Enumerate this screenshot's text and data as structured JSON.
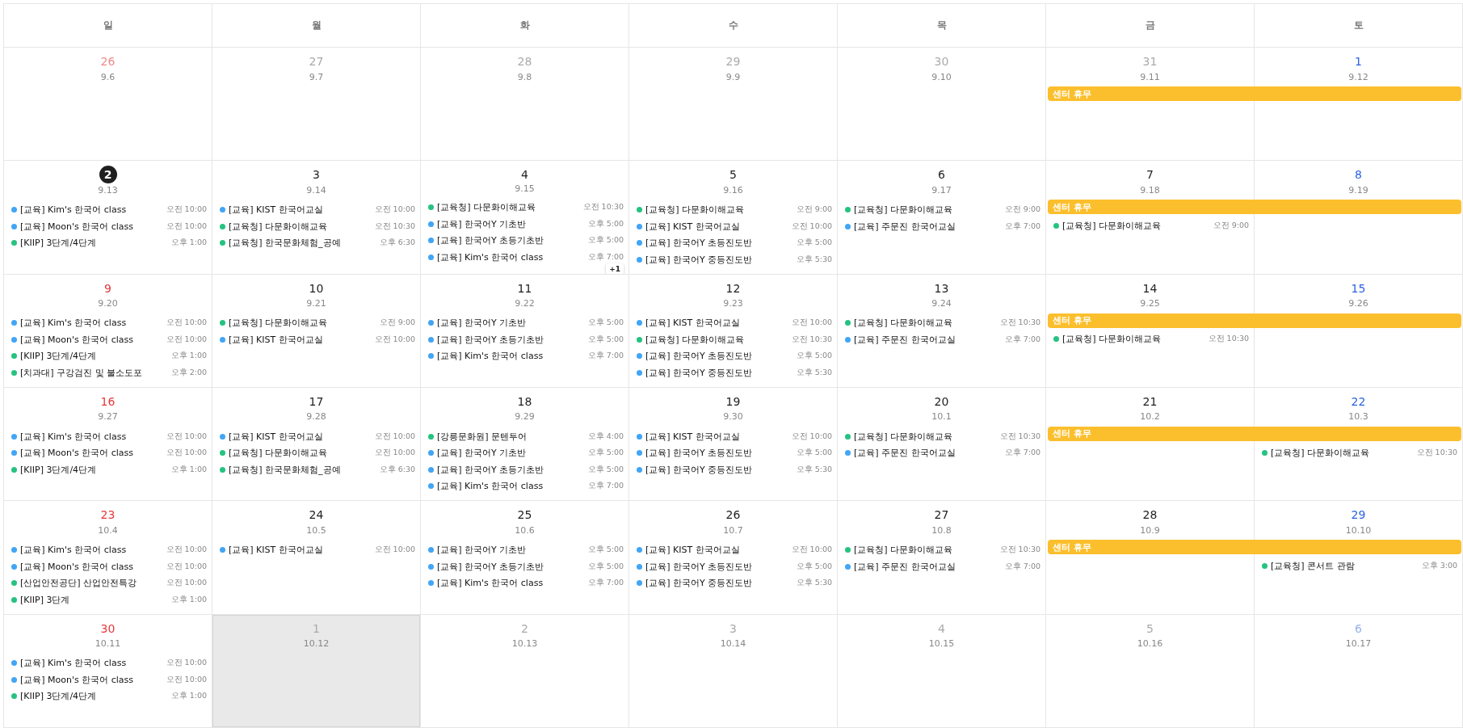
{
  "weekdays": [
    "일",
    "월",
    "화",
    "수",
    "목",
    "금",
    "토"
  ],
  "weeks": [
    {
      "days": [
        {
          "number": "26",
          "lunar": "9.6",
          "other_month": true,
          "today": false,
          "selected": false
        },
        {
          "number": "27",
          "lunar": "9.7",
          "other_month": true,
          "today": false,
          "selected": false
        },
        {
          "number": "28",
          "lunar": "9.8",
          "other_month": true,
          "today": false,
          "selected": false
        },
        {
          "number": "29",
          "lunar": "9.9",
          "other_month": true,
          "today": false,
          "selected": false
        },
        {
          "number": "30",
          "lunar": "9.10",
          "other_month": true,
          "today": false,
          "selected": false
        },
        {
          "number": "31",
          "lunar": "9.11",
          "other_month": true,
          "today": false,
          "selected": false,
          "all_day": {
            "title": "센터 휴무",
            "color": "#fbbf2d"
          }
        },
        {
          "number": "1",
          "lunar": "9.12",
          "other_month": false,
          "today": false,
          "selected": false,
          "all_day_continues": true
        }
      ]
    },
    {
      "days": [
        {
          "number": "2",
          "lunar": "9.13",
          "other_month": false,
          "today": true,
          "selected": false,
          "events": [
            {
              "title": "[교육] Kim's 한국어 class",
              "time": "오전 10:00",
              "color": "#42a5f5"
            },
            {
              "title": "[교육] Moon's 한국어 class",
              "time": "오전 10:00",
              "color": "#42a5f5"
            },
            {
              "title": "[KIIP] 3단계/4단계",
              "time": "오후 1:00",
              "color": "#26c281"
            }
          ]
        },
        {
          "number": "3",
          "lunar": "9.14",
          "other_month": false,
          "today": false,
          "selected": false,
          "events": [
            {
              "title": "[교육] KIST 한국어교실",
              "time": "오전 10:00",
              "color": "#42a5f5"
            },
            {
              "title": "[교육청] 다문화이해교육",
              "time": "오전 10:30",
              "color": "#26c281"
            },
            {
              "title": "[교육청] 한국문화체험_공예",
              "time": "오후 6:30",
              "color": "#26c281"
            }
          ]
        },
        {
          "number": "4",
          "lunar": "9.15",
          "other_month": false,
          "today": false,
          "selected": false,
          "more": "+1",
          "events": [
            {
              "title": "[교육청] 다문화이해교육",
              "time": "오전 10:30",
              "color": "#26c281"
            },
            {
              "title": "[교육] 한국어Y 기초반",
              "time": "오후 5:00",
              "color": "#42a5f5"
            },
            {
              "title": "[교육] 한국어Y 초등기초반",
              "time": "오후 5:00",
              "color": "#42a5f5"
            },
            {
              "title": "[교육] Kim's 한국어 class",
              "time": "오후 7:00",
              "color": "#42a5f5"
            }
          ]
        },
        {
          "number": "5",
          "lunar": "9.16",
          "other_month": false,
          "today": false,
          "selected": false,
          "events": [
            {
              "title": "[교육청] 다문화이해교육",
              "time": "오전 9:00",
              "color": "#26c281"
            },
            {
              "title": "[교육] KIST 한국어교실",
              "time": "오전 10:00",
              "color": "#42a5f5"
            },
            {
              "title": "[교육] 한국어Y 초등진도반",
              "time": "오후 5:00",
              "color": "#42a5f5"
            },
            {
              "title": "[교육] 한국어Y 중등진도반",
              "time": "오후 5:30",
              "color": "#42a5f5"
            }
          ]
        },
        {
          "number": "6",
          "lunar": "9.17",
          "other_month": false,
          "today": false,
          "selected": false,
          "events": [
            {
              "title": "[교육청] 다문화이해교육",
              "time": "오전 9:00",
              "color": "#26c281"
            },
            {
              "title": "[교육] 주문진 한국어교실",
              "time": "오후 7:00",
              "color": "#42a5f5"
            }
          ]
        },
        {
          "number": "7",
          "lunar": "9.18",
          "other_month": false,
          "today": false,
          "selected": false,
          "all_day": {
            "title": "센터 휴무",
            "color": "#fbbf2d"
          },
          "events": [
            {
              "title": "[교육청] 다문화이해교육",
              "time": "오전 9:00",
              "color": "#26c281"
            }
          ]
        },
        {
          "number": "8",
          "lunar": "9.19",
          "other_month": false,
          "today": false,
          "selected": false,
          "all_day_continues": true
        }
      ]
    },
    {
      "days": [
        {
          "number": "9",
          "lunar": "9.20",
          "other_month": false,
          "today": false,
          "selected": false,
          "events": [
            {
              "title": "[교육] Kim's 한국어 class",
              "time": "오전 10:00",
              "color": "#42a5f5"
            },
            {
              "title": "[교육] Moon's 한국어 class",
              "time": "오전 10:00",
              "color": "#42a5f5"
            },
            {
              "title": "[KIIP] 3단계/4단계",
              "time": "오후 1:00",
              "color": "#26c281"
            },
            {
              "title": "[치과대] 구강검진 및 불소도포",
              "time": "오후 2:00",
              "color": "#26c281"
            }
          ]
        },
        {
          "number": "10",
          "lunar": "9.21",
          "other_month": false,
          "today": false,
          "selected": false,
          "events": [
            {
              "title": "[교육청] 다문화이해교육",
              "time": "오전 9:00",
              "color": "#26c281"
            },
            {
              "title": "[교육] KIST 한국어교실",
              "time": "오전 10:00",
              "color": "#42a5f5"
            }
          ]
        },
        {
          "number": "11",
          "lunar": "9.22",
          "other_month": false,
          "today": false,
          "selected": false,
          "events": [
            {
              "title": "[교육] 한국어Y 기초반",
              "time": "오후 5:00",
              "color": "#42a5f5"
            },
            {
              "title": "[교육] 한국어Y 초등기초반",
              "time": "오후 5:00",
              "color": "#42a5f5"
            },
            {
              "title": "[교육] Kim's 한국어 class",
              "time": "오후 7:00",
              "color": "#42a5f5"
            }
          ]
        },
        {
          "number": "12",
          "lunar": "9.23",
          "other_month": false,
          "today": false,
          "selected": false,
          "events": [
            {
              "title": "[교육] KIST 한국어교실",
              "time": "오전 10:00",
              "color": "#42a5f5"
            },
            {
              "title": "[교육청] 다문화이해교육",
              "time": "오전 10:30",
              "color": "#26c281"
            },
            {
              "title": "[교육] 한국어Y 초등진도반",
              "time": "오후 5:00",
              "color": "#42a5f5"
            },
            {
              "title": "[교육] 한국어Y 중등진도반",
              "time": "오후 5:30",
              "color": "#42a5f5"
            }
          ]
        },
        {
          "number": "13",
          "lunar": "9.24",
          "other_month": false,
          "today": false,
          "selected": false,
          "events": [
            {
              "title": "[교육청] 다문화이해교육",
              "time": "오전 10:30",
              "color": "#26c281"
            },
            {
              "title": "[교육] 주문진 한국어교실",
              "time": "오후 7:00",
              "color": "#42a5f5"
            }
          ]
        },
        {
          "number": "14",
          "lunar": "9.25",
          "other_month": false,
          "today": false,
          "selected": false,
          "all_day": {
            "title": "센터 휴무",
            "color": "#fbbf2d"
          },
          "events": [
            {
              "title": "[교육청] 다문화이해교육",
              "time": "오전 10:30",
              "color": "#26c281"
            }
          ]
        },
        {
          "number": "15",
          "lunar": "9.26",
          "other_month": false,
          "today": false,
          "selected": false,
          "all_day_continues": true
        }
      ]
    },
    {
      "days": [
        {
          "number": "16",
          "lunar": "9.27",
          "other_month": false,
          "today": false,
          "selected": false,
          "events": [
            {
              "title": "[교육] Kim's 한국어 class",
              "time": "오전 10:00",
              "color": "#42a5f5"
            },
            {
              "title": "[교육] Moon's 한국어 class",
              "time": "오전 10:00",
              "color": "#42a5f5"
            },
            {
              "title": "[KIIP] 3단계/4단계",
              "time": "오후 1:00",
              "color": "#26c281"
            }
          ]
        },
        {
          "number": "17",
          "lunar": "9.28",
          "other_month": false,
          "today": false,
          "selected": false,
          "events": [
            {
              "title": "[교육] KIST 한국어교실",
              "time": "오전 10:00",
              "color": "#42a5f5"
            },
            {
              "title": "[교육청] 다문화이해교육",
              "time": "오전 10:00",
              "color": "#26c281"
            },
            {
              "title": "[교육청] 한국문화체험_공예",
              "time": "오후 6:30",
              "color": "#26c281"
            }
          ]
        },
        {
          "number": "18",
          "lunar": "9.29",
          "other_month": false,
          "today": false,
          "selected": false,
          "events": [
            {
              "title": "[강릉문화원] 문텐투어",
              "time": "오후 4:00",
              "color": "#26c281"
            },
            {
              "title": "[교육] 한국어Y 기초반",
              "time": "오후 5:00",
              "color": "#42a5f5"
            },
            {
              "title": "[교육] 한국어Y 초등기초반",
              "time": "오후 5:00",
              "color": "#42a5f5"
            },
            {
              "title": "[교육] Kim's 한국어 class",
              "time": "오후 7:00",
              "color": "#42a5f5"
            }
          ]
        },
        {
          "number": "19",
          "lunar": "9.30",
          "other_month": false,
          "today": false,
          "selected": false,
          "events": [
            {
              "title": "[교육] KIST 한국어교실",
              "time": "오전 10:00",
              "color": "#42a5f5"
            },
            {
              "title": "[교육] 한국어Y 초등진도반",
              "time": "오후 5:00",
              "color": "#42a5f5"
            },
            {
              "title": "[교육] 한국어Y 중등진도반",
              "time": "오후 5:30",
              "color": "#42a5f5"
            }
          ]
        },
        {
          "number": "20",
          "lunar": "10.1",
          "other_month": false,
          "today": false,
          "selected": false,
          "events": [
            {
              "title": "[교육청] 다문화이해교육",
              "time": "오전 10:30",
              "color": "#26c281"
            },
            {
              "title": "[교육] 주문진 한국어교실",
              "time": "오후 7:00",
              "color": "#42a5f5"
            }
          ]
        },
        {
          "number": "21",
          "lunar": "10.2",
          "other_month": false,
          "today": false,
          "selected": false,
          "all_day": {
            "title": "센터 휴무",
            "color": "#fbbf2d"
          }
        },
        {
          "number": "22",
          "lunar": "10.3",
          "other_month": false,
          "today": false,
          "selected": false,
          "all_day_continues": true,
          "events": [
            {
              "title": "[교육청] 다문화이해교육",
              "time": "오전 10:30",
              "color": "#26c281"
            }
          ]
        }
      ]
    },
    {
      "days": [
        {
          "number": "23",
          "lunar": "10.4",
          "other_month": false,
          "today": false,
          "selected": false,
          "events": [
            {
              "title": "[교육] Kim's 한국어 class",
              "time": "오전 10:00",
              "color": "#42a5f5"
            },
            {
              "title": "[교육] Moon's 한국어 class",
              "time": "오전 10:00",
              "color": "#42a5f5"
            },
            {
              "title": "[산업안전공단] 산업안전특강",
              "time": "오전 10:00",
              "color": "#26c281"
            },
            {
              "title": "[KIIP] 3단계",
              "time": "오후 1:00",
              "color": "#26c281"
            }
          ]
        },
        {
          "number": "24",
          "lunar": "10.5",
          "other_month": false,
          "today": false,
          "selected": false,
          "events": [
            {
              "title": "[교육] KIST 한국어교실",
              "time": "오전 10:00",
              "color": "#42a5f5"
            }
          ]
        },
        {
          "number": "25",
          "lunar": "10.6",
          "other_month": false,
          "today": false,
          "selected": false,
          "events": [
            {
              "title": "[교육] 한국어Y 기초반",
              "time": "오후 5:00",
              "color": "#42a5f5"
            },
            {
              "title": "[교육] 한국어Y 초등기초반",
              "time": "오후 5:00",
              "color": "#42a5f5"
            },
            {
              "title": "[교육] Kim's 한국어 class",
              "time": "오후 7:00",
              "color": "#42a5f5"
            }
          ]
        },
        {
          "number": "26",
          "lunar": "10.7",
          "other_month": false,
          "today": false,
          "selected": false,
          "events": [
            {
              "title": "[교육] KIST 한국어교실",
              "time": "오전 10:00",
              "color": "#42a5f5"
            },
            {
              "title": "[교육] 한국어Y 초등진도반",
              "time": "오후 5:00",
              "color": "#42a5f5"
            },
            {
              "title": "[교육] 한국어Y 중등진도반",
              "time": "오후 5:30",
              "color": "#42a5f5"
            }
          ]
        },
        {
          "number": "27",
          "lunar": "10.8",
          "other_month": false,
          "today": false,
          "selected": false,
          "events": [
            {
              "title": "[교육청] 다문화이해교육",
              "time": "오전 10:30",
              "color": "#26c281"
            },
            {
              "title": "[교육] 주문진 한국어교실",
              "time": "오후 7:00",
              "color": "#42a5f5"
            }
          ]
        },
        {
          "number": "28",
          "lunar": "10.9",
          "other_month": false,
          "today": false,
          "selected": false,
          "all_day": {
            "title": "센터 휴무",
            "color": "#fbbf2d"
          }
        },
        {
          "number": "29",
          "lunar": "10.10",
          "other_month": false,
          "today": false,
          "selected": false,
          "all_day_continues": true,
          "events": [
            {
              "title": "[교육청] 콘서트 관람",
              "time": "오후 3:00",
              "color": "#26c281"
            }
          ]
        }
      ]
    },
    {
      "days": [
        {
          "number": "30",
          "lunar": "10.11",
          "other_month": false,
          "today": false,
          "selected": false,
          "events": [
            {
              "title": "[교육] Kim's 한국어 class",
              "time": "오전 10:00",
              "color": "#42a5f5"
            },
            {
              "title": "[교육] Moon's 한국어 class",
              "time": "오전 10:00",
              "color": "#42a5f5"
            },
            {
              "title": "[KIIP] 3단계/4단계",
              "time": "오후 1:00",
              "color": "#26c281"
            }
          ]
        },
        {
          "number": "1",
          "lunar": "10.12",
          "other_month": true,
          "today": false,
          "selected": true
        },
        {
          "number": "2",
          "lunar": "10.13",
          "other_month": true,
          "today": false,
          "selected": false
        },
        {
          "number": "3",
          "lunar": "10.14",
          "other_month": true,
          "today": false,
          "selected": false
        },
        {
          "number": "4",
          "lunar": "10.15",
          "other_month": true,
          "today": false,
          "selected": false
        },
        {
          "number": "5",
          "lunar": "10.16",
          "other_month": true,
          "today": false,
          "selected": false
        },
        {
          "number": "6",
          "lunar": "10.17",
          "other_month": true,
          "today": false,
          "selected": false
        }
      ]
    }
  ]
}
